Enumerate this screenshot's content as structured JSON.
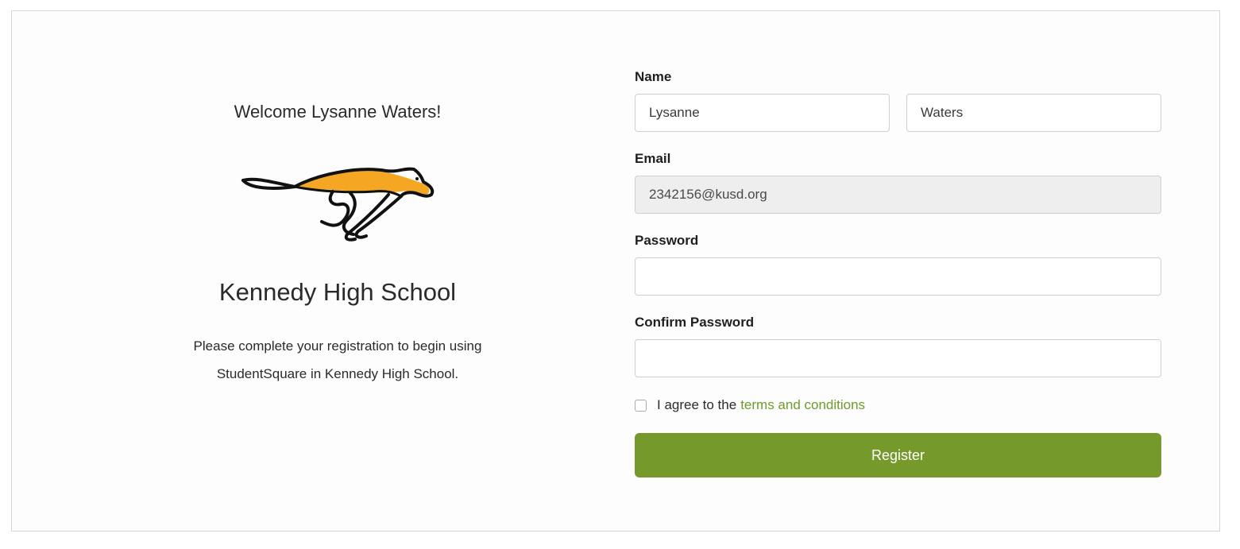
{
  "welcome": {
    "greeting": "Welcome Lysanne Waters!",
    "school_name": "Kennedy High School",
    "description_line1": "Please complete your registration to begin using",
    "description_line2": "StudentSquare in Kennedy High School.",
    "logo_icon": "cheetah-logo-icon",
    "logo_colors": {
      "outline": "#111111",
      "fill": "#f5a623"
    }
  },
  "form": {
    "name_label": "Name",
    "first_name_value": "Lysanne",
    "last_name_value": "Waters",
    "email_label": "Email",
    "email_value": "2342156@kusd.org",
    "password_label": "Password",
    "password_value": "",
    "confirm_password_label": "Confirm Password",
    "confirm_password_value": "",
    "agree_text": "I agree to the",
    "terms_link": "terms and conditions",
    "agree_checked": false,
    "register_label": "Register"
  },
  "colors": {
    "accent": "#76992c",
    "link": "#6e9b2b",
    "disabled_field": "#eeeeee"
  }
}
